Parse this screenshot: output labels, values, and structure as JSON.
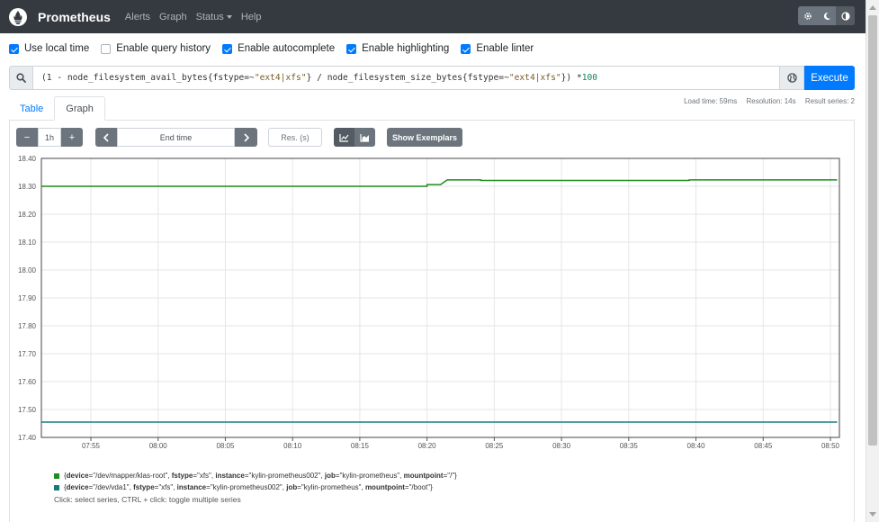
{
  "navbar": {
    "brand": "Prometheus",
    "links": [
      {
        "label": "Alerts"
      },
      {
        "label": "Graph"
      },
      {
        "label": "Status"
      },
      {
        "label": "Help"
      }
    ],
    "theme_icons": [
      "gear-icon",
      "moon-icon",
      "half-circle-icon"
    ]
  },
  "options": [
    {
      "label": "Use local time",
      "checked": true
    },
    {
      "label": "Enable query history",
      "checked": false
    },
    {
      "label": "Enable autocomplete",
      "checked": true
    },
    {
      "label": "Enable highlighting",
      "checked": true
    },
    {
      "label": "Enable linter",
      "checked": true
    }
  ],
  "expression": {
    "p1": "(1 - node_filesystem_avail_bytes{fstype=~",
    "s1": "\"ext4|xfs\"",
    "p2": "} / node_filesystem_size_bytes{fstype=~",
    "s2": "\"ext4|xfs\"",
    "p3": "}) * ",
    "n1": "100"
  },
  "execute_label": "Execute",
  "stats": {
    "load_time": "Load time: 59ms",
    "resolution": "Resolution: 14s",
    "result_series": "Result series: 2"
  },
  "tabs": [
    {
      "label": "Table",
      "active": false
    },
    {
      "label": "Graph",
      "active": true
    }
  ],
  "controls": {
    "minus": "−",
    "range": "1h",
    "plus": "+",
    "end_time_placeholder": "End time",
    "res_placeholder": "Res. (s)",
    "show_exemplars": "Show Exemplars"
  },
  "chart_data": {
    "type": "line",
    "ylim": [
      17.4,
      18.4
    ],
    "yticks": [
      "18.40",
      "18.30",
      "18.20",
      "18.10",
      "18.00",
      "17.90",
      "17.80",
      "17.70",
      "17.60",
      "17.50",
      "17.40"
    ],
    "xticks": [
      "07:55",
      "08:00",
      "08:05",
      "08:10",
      "08:15",
      "08:20",
      "08:25",
      "08:30",
      "08:35",
      "08:40",
      "08:45",
      "08:50"
    ],
    "grid": true,
    "series": [
      {
        "color": "#1e8c1e",
        "points": [
          [
            "07:51",
            18.3
          ],
          [
            "08:20",
            18.3
          ],
          [
            "08:20",
            18.306
          ],
          [
            "08:21",
            18.306
          ],
          [
            "08:21:30",
            18.323
          ],
          [
            "08:24",
            18.323
          ],
          [
            "08:24",
            18.321
          ],
          [
            "08:39:30",
            18.321
          ],
          [
            "08:39:30",
            18.323
          ],
          [
            "08:50:30",
            18.323
          ]
        ]
      },
      {
        "color": "#177a7a",
        "points": [
          [
            "07:51",
            17.455
          ],
          [
            "08:50:30",
            17.455
          ]
        ]
      }
    ]
  },
  "legend": [
    {
      "color": "#1e8c1e",
      "labels": [
        {
          "k": "device",
          "v": "\"/dev/mapper/klas-root\""
        },
        {
          "k": "fstype",
          "v": "\"xfs\""
        },
        {
          "k": "instance",
          "v": "\"kylin-prometheus002\""
        },
        {
          "k": "job",
          "v": "\"kylin-prometheus\""
        },
        {
          "k": "mountpoint",
          "v": "\"/\""
        }
      ]
    },
    {
      "color": "#177a7a",
      "labels": [
        {
          "k": "device",
          "v": "\"/dev/vda1\""
        },
        {
          "k": "fstype",
          "v": "\"xfs\""
        },
        {
          "k": "instance",
          "v": "\"kylin-prometheus002\""
        },
        {
          "k": "job",
          "v": "\"kylin-prometheus\""
        },
        {
          "k": "mountpoint",
          "v": "\"/boot\""
        }
      ]
    }
  ],
  "hint": "Click: select series, CTRL + click: toggle multiple series"
}
